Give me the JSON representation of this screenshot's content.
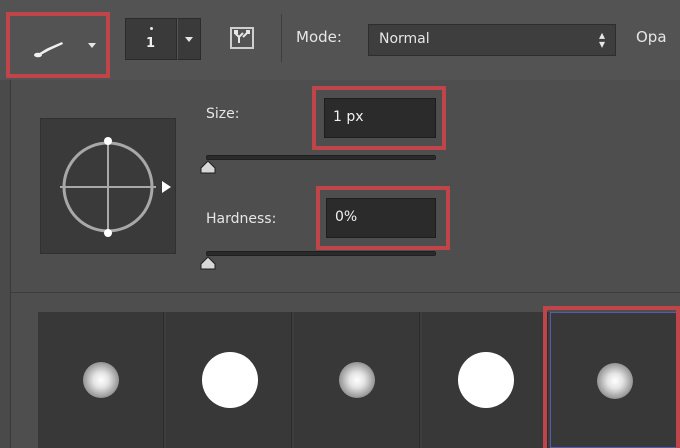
{
  "toolbar": {
    "brush_size_value": "1",
    "mode_label": "Mode:",
    "mode_value": "Normal",
    "opacity_label_partial": "Opa"
  },
  "brush_panel": {
    "size_label": "Size:",
    "size_value": "1 px",
    "hardness_label": "Hardness:",
    "hardness_value": "0%",
    "size_slider_level": 0,
    "hardness_slider_level": 0
  },
  "presets": [
    {
      "kind": "soft",
      "selected": false
    },
    {
      "kind": "hard",
      "selected": false
    },
    {
      "kind": "soft",
      "selected": false
    },
    {
      "kind": "hard",
      "selected": false
    },
    {
      "kind": "soft",
      "selected": true
    }
  ],
  "colors": {
    "highlight": "#c0454b",
    "panel": "#4e4e4e",
    "field": "#2b2b2b",
    "selected_outline": "#5a5ab0"
  },
  "icons": [
    "brush-icon",
    "dropdown-arrow-icon",
    "brush-panel-toggle-icon",
    "angle-crosshair-icon",
    "slider-thumb-icon"
  ]
}
